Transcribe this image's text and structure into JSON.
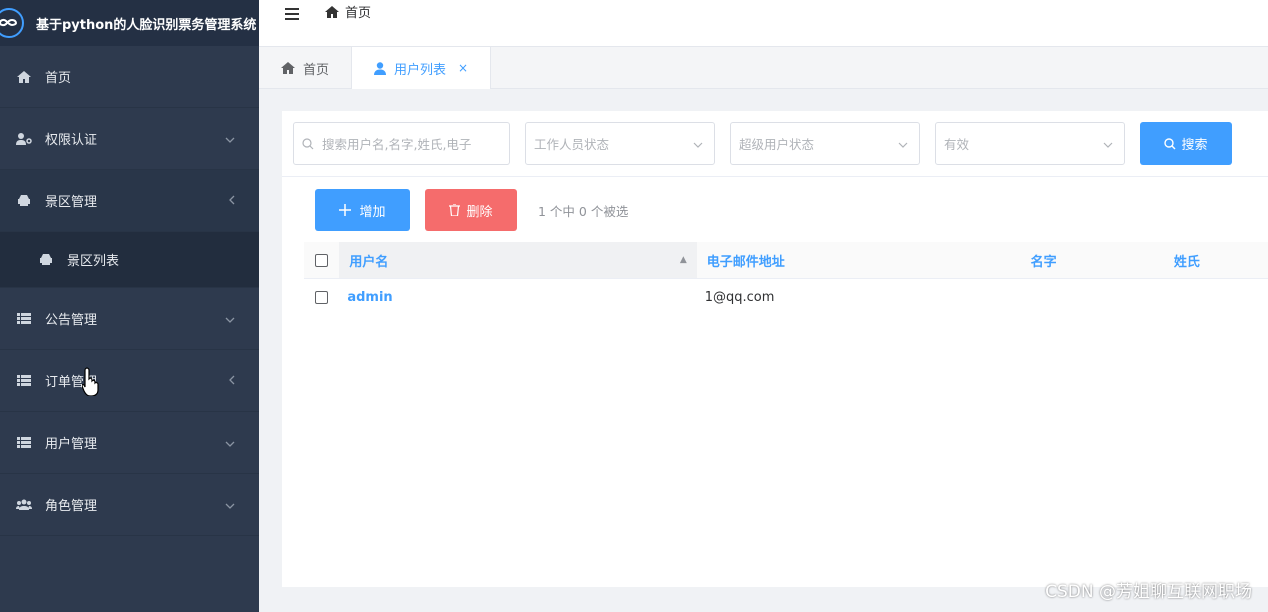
{
  "app": {
    "title": "基于python的人脸识别票务管理系统"
  },
  "sidebar": {
    "items": [
      {
        "label": "首页",
        "icon": "home-icon"
      },
      {
        "label": "权限认证",
        "icon": "user-key-icon"
      },
      {
        "label": "景区管理",
        "icon": "car-icon"
      },
      {
        "label": "景区列表",
        "icon": "car-icon"
      },
      {
        "label": "公告管理",
        "icon": "list-icon"
      },
      {
        "label": "订单管理",
        "icon": "list-icon"
      },
      {
        "label": "用户管理",
        "icon": "list-icon"
      },
      {
        "label": "角色管理",
        "icon": "users-icon"
      }
    ]
  },
  "topbar": {
    "breadcrumb": "首页"
  },
  "tabs": [
    {
      "label": "首页",
      "icon": "home-icon"
    },
    {
      "label": "用户列表",
      "icon": "user-icon",
      "close": "×"
    }
  ],
  "filters": {
    "search_placeholder": "搜索用户名,名字,姓氏,电子",
    "staff_status_placeholder": "工作人员状态",
    "superuser_status_placeholder": "超级用户状态",
    "active_placeholder": "有效",
    "search_button": "搜索"
  },
  "actions": {
    "add_label": "增加",
    "delete_label": "删除",
    "selection_text": "1 个中 0 个被选"
  },
  "table": {
    "columns": [
      "用户名",
      "电子邮件地址",
      "名字",
      "姓氏"
    ],
    "rows": [
      {
        "username": "admin",
        "email": "1@qq.com",
        "first_name": "",
        "last_name": ""
      }
    ]
  },
  "watermark": "CSDN @芳姐聊互联网职场",
  "colors": {
    "sidebar_bg": "#2e3a4e",
    "primary": "#409eff",
    "danger": "#f56c6c"
  }
}
